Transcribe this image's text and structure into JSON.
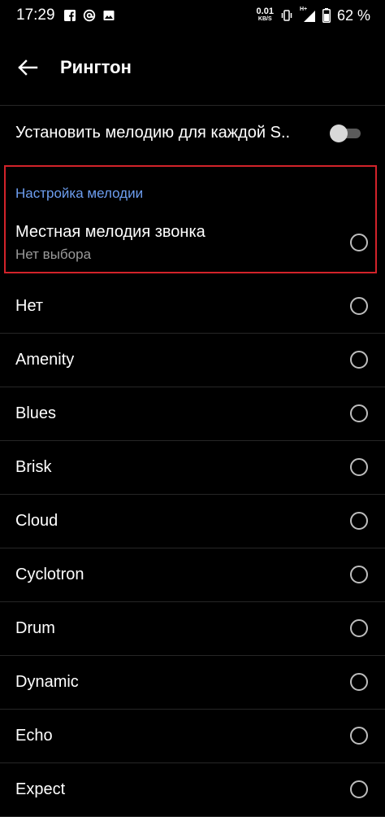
{
  "status_bar": {
    "time": "17:29",
    "left_icons": [
      "facebook-icon",
      "at-sign-icon",
      "image-icon"
    ],
    "net_speed_value": "0.01",
    "net_speed_unit": "KB/S",
    "signal_label": "H+",
    "battery_text": "62 %"
  },
  "app_bar": {
    "title": "Рингтон",
    "back_icon": "arrow-left-icon"
  },
  "toggle_row": {
    "label": "Установить мелодию для каждой S..",
    "enabled": false
  },
  "section": {
    "header": "Настройка мелодии",
    "local_title": "Местная мелодия звонка",
    "local_subtitle": "Нет выбора"
  },
  "ringtones": [
    {
      "label": "Нет"
    },
    {
      "label": "Amenity"
    },
    {
      "label": "Blues"
    },
    {
      "label": "Brisk"
    },
    {
      "label": "Cloud"
    },
    {
      "label": "Cyclotron"
    },
    {
      "label": "Drum"
    },
    {
      "label": "Dynamic"
    },
    {
      "label": "Echo"
    },
    {
      "label": "Expect"
    }
  ],
  "colors": {
    "background": "#000000",
    "section_header": "#6d9ef0",
    "highlight_border": "#d2232a"
  }
}
